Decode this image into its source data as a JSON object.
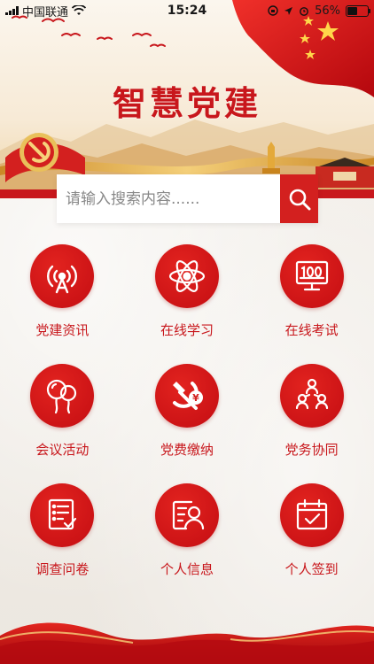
{
  "status": {
    "carrier": "中国联通",
    "time": "15:24",
    "battery": "56%",
    "battery_level": 0.56
  },
  "app": {
    "title": "智慧党建"
  },
  "search": {
    "placeholder": "请输入搜索内容......"
  },
  "menu": [
    {
      "label": "党建资讯",
      "icon": "signal-tower-icon"
    },
    {
      "label": "在线学习",
      "icon": "atom-icon"
    },
    {
      "label": "在线考试",
      "icon": "monitor-score-icon"
    },
    {
      "label": "会议活动",
      "icon": "balloons-icon"
    },
    {
      "label": "党费缴纳",
      "icon": "party-emblem-yuan-icon"
    },
    {
      "label": "党务协同",
      "icon": "team-hierarchy-icon"
    },
    {
      "label": "调查问卷",
      "icon": "questionnaire-icon"
    },
    {
      "label": "个人信息",
      "icon": "profile-card-icon"
    },
    {
      "label": "个人签到",
      "icon": "calendar-check-icon"
    }
  ],
  "colors": {
    "accent": "#d3201f",
    "label": "#c8171c",
    "background": "#f3efea"
  }
}
